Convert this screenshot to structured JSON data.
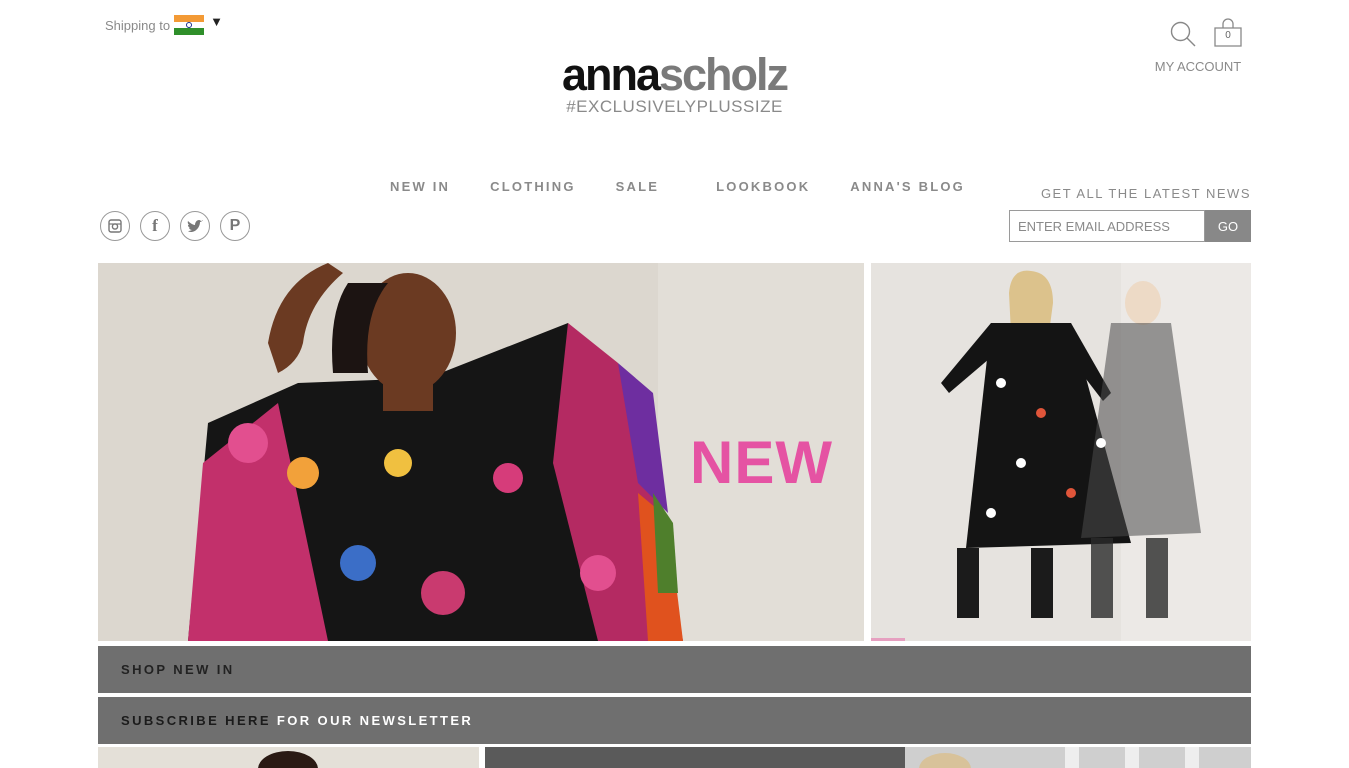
{
  "header": {
    "shipping_label": "Shipping to",
    "shipping_country_icon": "india-flag-icon",
    "logo_part1": "anna",
    "logo_part2": "scholz",
    "tagline": "#EXCLUSIVELYPLUSSIZE",
    "cart_count": "0",
    "my_account": "MY ACCOUNT"
  },
  "nav": {
    "items": [
      {
        "label": "NEW IN"
      },
      {
        "label": "CLOTHING"
      },
      {
        "label": "SALE"
      },
      {
        "label": "LOOKBOOK"
      },
      {
        "label": "ANNA'S BLOG"
      }
    ]
  },
  "social": [
    "instagram-icon",
    "facebook-icon",
    "twitter-icon",
    "pinterest-icon"
  ],
  "newsletter": {
    "heading": "GET ALL THE LATEST NEWS",
    "placeholder": "ENTER EMAIL ADDRESS",
    "button": "GO"
  },
  "hero": {
    "overlay_text": "NEW"
  },
  "bars": {
    "shop": "SHOP NEW IN",
    "subscribe_part1": "SUBSCRIBE HERE",
    "subscribe_part2": "FOR OUR NEWSLETTER"
  },
  "colors": {
    "accent_pink": "#e553a3",
    "bar_gray": "#6f6f6f",
    "button_gray": "#888888"
  }
}
